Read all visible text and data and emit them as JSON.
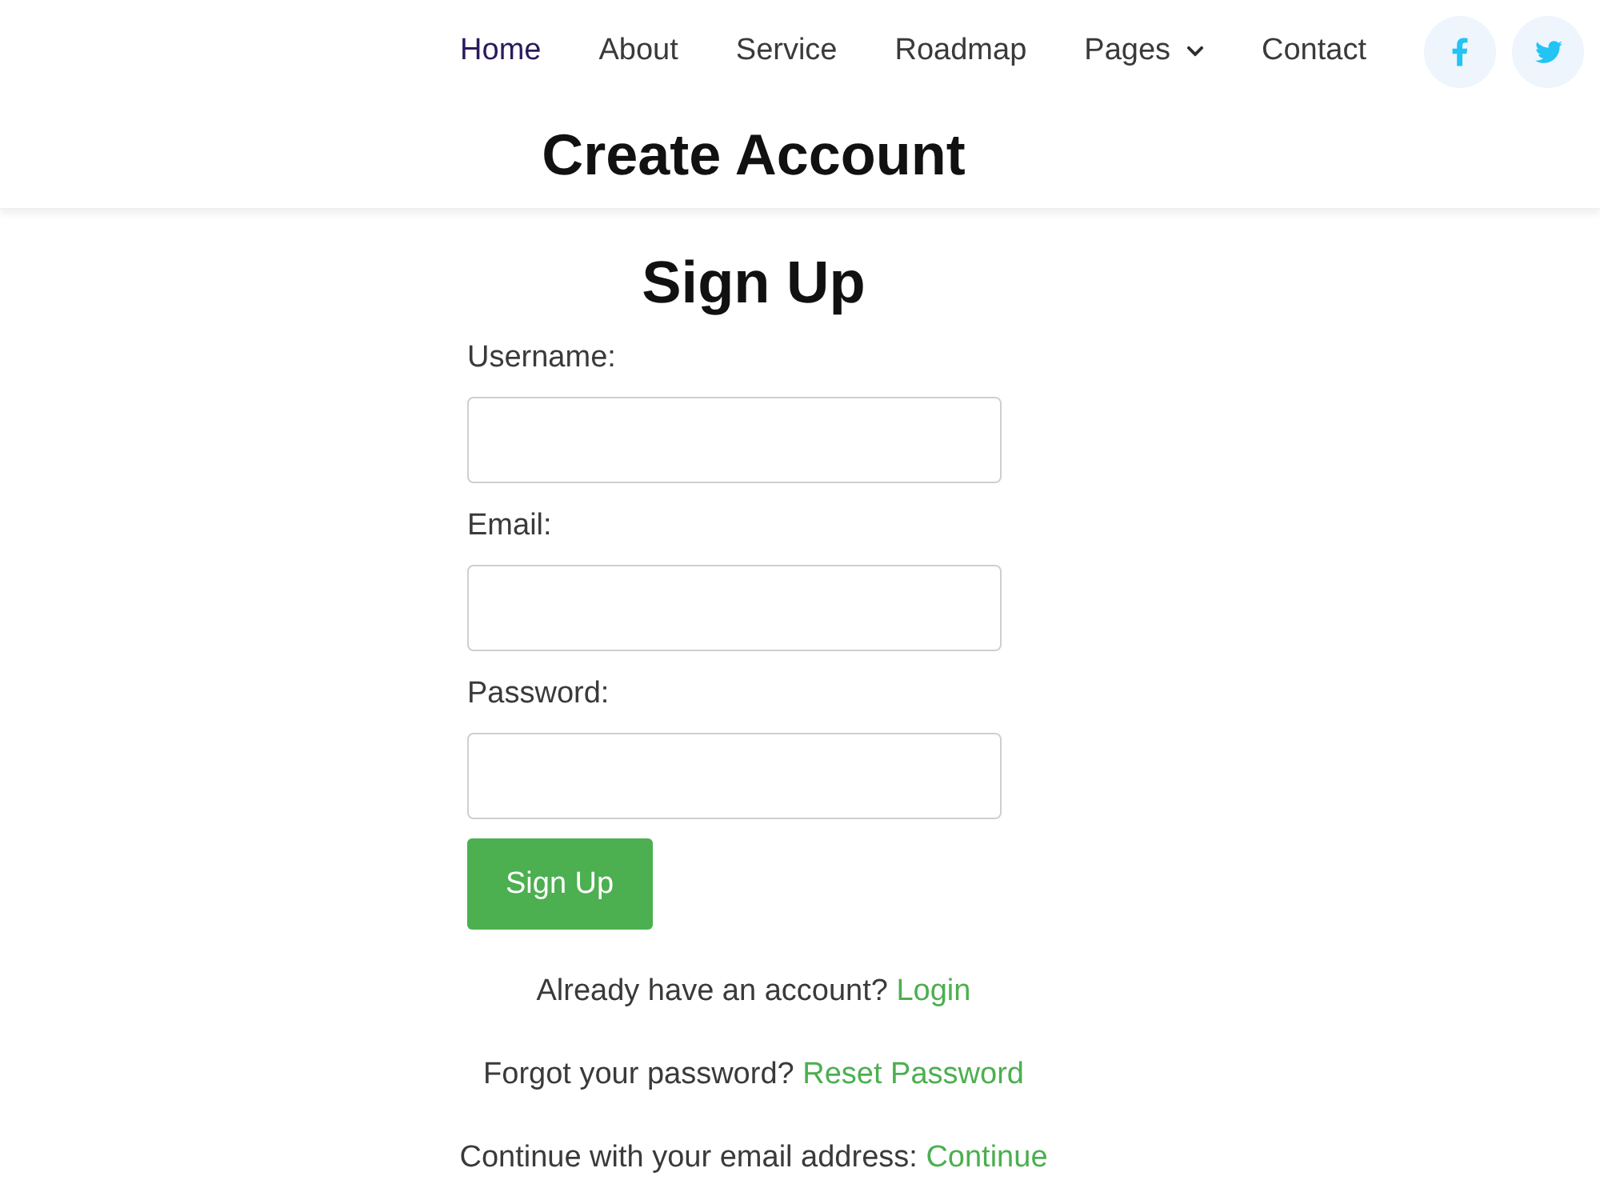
{
  "nav": {
    "items": [
      {
        "label": "Home",
        "selected": true,
        "kind": "link"
      },
      {
        "label": "About",
        "selected": false,
        "kind": "link"
      },
      {
        "label": "Service",
        "selected": false,
        "kind": "link"
      },
      {
        "label": "Roadmap",
        "selected": false,
        "kind": "link"
      },
      {
        "label": "Pages",
        "selected": false,
        "kind": "dropdown"
      },
      {
        "label": "Contact",
        "selected": false,
        "kind": "link"
      }
    ],
    "social": [
      {
        "kind": "facebook"
      },
      {
        "kind": "twitter"
      }
    ]
  },
  "page_title": "Create Account",
  "form": {
    "title": "Sign Up",
    "fields": [
      {
        "label": "Username:"
      },
      {
        "label": "Email:"
      },
      {
        "label": "Password:"
      }
    ],
    "submit": "Sign Up"
  },
  "links": [
    {
      "text": "Already have an account?",
      "link": "Login"
    },
    {
      "text": "Forgot your password?",
      "link": "Reset Password"
    },
    {
      "text": "Continue with your email address:",
      "link": "Continue"
    }
  ]
}
